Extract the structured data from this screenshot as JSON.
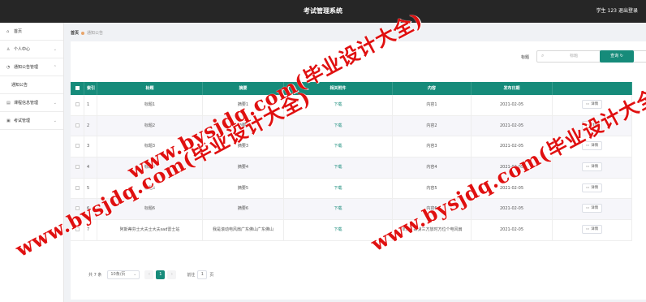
{
  "header": {
    "title": "考试管理系统",
    "user": "学生 123",
    "logout": "退出登录"
  },
  "sidebar": {
    "items": [
      {
        "label": "首页",
        "icon": "home-icon"
      },
      {
        "label": "个人中心",
        "icon": "user-icon"
      },
      {
        "label": "通知公告管理",
        "icon": "bell-icon"
      },
      {
        "label": "课程信息管理",
        "icon": "book-icon"
      },
      {
        "label": "考试管理",
        "icon": "exam-icon"
      }
    ],
    "sub_item": "通知公告"
  },
  "breadcrumb": {
    "home": "首页",
    "current": "通知公告"
  },
  "search": {
    "label": "标题",
    "placeholder": "标题",
    "button": "查询"
  },
  "table": {
    "columns": [
      "索引",
      "标题",
      "摘要",
      "相关附件",
      "内容",
      "发布日期",
      ""
    ],
    "rows": [
      {
        "idx": "1",
        "title": "标题1",
        "summary": "摘要1",
        "attachment": "下载",
        "content": "内容1",
        "date": "2021-02-05",
        "action": "详情"
      },
      {
        "idx": "2",
        "title": "标题2",
        "summary": "摘要2",
        "attachment": "下载",
        "content": "内容2",
        "date": "2021-02-05",
        "action": "详情"
      },
      {
        "idx": "3",
        "title": "标题3",
        "summary": "摘要3",
        "attachment": "下载",
        "content": "内容3",
        "date": "2021-02-05",
        "action": "详情"
      },
      {
        "idx": "4",
        "title": "标题4",
        "summary": "摘要4",
        "attachment": "下载",
        "content": "内容4",
        "date": "2021-02-05",
        "action": "详情"
      },
      {
        "idx": "5",
        "title": "标题5",
        "summary": "摘要5",
        "attachment": "下载",
        "content": "内容5",
        "date": "2021-02-05",
        "action": "详情"
      },
      {
        "idx": "6",
        "title": "标题6",
        "summary": "摘要6",
        "attachment": "下载",
        "content": "内容6",
        "date": "2021-02-05",
        "action": "详情"
      },
      {
        "idx": "7",
        "title": "阿斯蒂芬士大夫士大夫sad雷士站",
        "summary": "我是滚动电风扇广东佛山广东佛山",
        "attachment": "下载",
        "content": "单方事故第三方放时方位个电风扇",
        "date": "2021-02-05",
        "action": "详情"
      }
    ]
  },
  "pagination": {
    "total": "共 7 条",
    "page_size": "10条/页",
    "prev": "‹",
    "current": "1",
    "next": "›",
    "goto": "前往",
    "goto_value": "1",
    "page_unit": "页"
  },
  "watermark": "www.bysjdq.com(毕业设计大全)",
  "colors": {
    "topbar": "#262626",
    "accent": "#168b7a",
    "watermark": "#e01010"
  }
}
